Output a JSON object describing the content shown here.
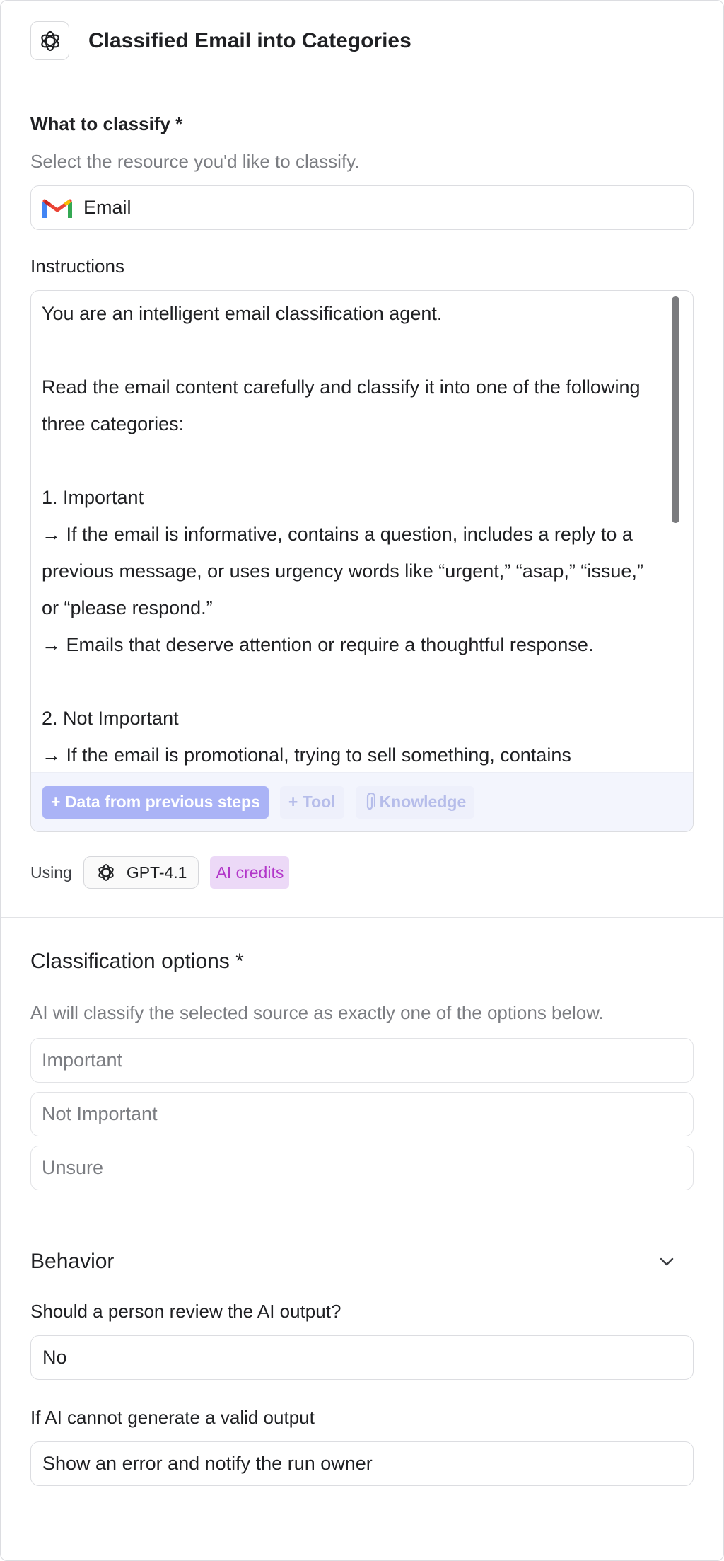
{
  "header": {
    "title": "Classified Email into Categories",
    "logo_icon": "openai-logo-icon"
  },
  "classify": {
    "label": "What to classify *",
    "hint": "Select the resource you'd like to classify.",
    "source_icon": "gmail-icon",
    "source_value": "Email"
  },
  "instructions": {
    "label": "Instructions",
    "text": "You are an intelligent email classification agent.\n\nRead the email content carefully and classify it into one of the following three categories:\n\n1. Important\n→ If the email is informative, contains a question, includes a reply to a previous message, or uses urgency words like “urgent,” “asap,” “issue,” or “please respond.”\n→ Emails that deserve attention or require a thoughtful response.\n\n2. Not Important\n→ If the email is promotional, trying to sell something, contains",
    "toolbar": {
      "data_button": "+ Data from previous steps",
      "tool_button": "+ Tool",
      "knowledge_button": "Knowledge"
    }
  },
  "model": {
    "using_label": "Using",
    "name": "GPT-4.1",
    "credits_badge": "AI credits"
  },
  "classification": {
    "title": "Classification options *",
    "hint": "AI will classify the selected source as exactly one of the options below.",
    "options": [
      "Important",
      "Not Important",
      "Unsure"
    ]
  },
  "behavior": {
    "title": "Behavior",
    "review_label": "Should a person review the AI output?",
    "review_value": "No",
    "invalid_label": "If AI cannot generate a valid output",
    "invalid_value": "Show an error and notify the run owner"
  },
  "colors": {
    "accent_chip": "#aab3f6",
    "credits_text": "#b236c9",
    "credits_bg": "#ecd9f7"
  }
}
